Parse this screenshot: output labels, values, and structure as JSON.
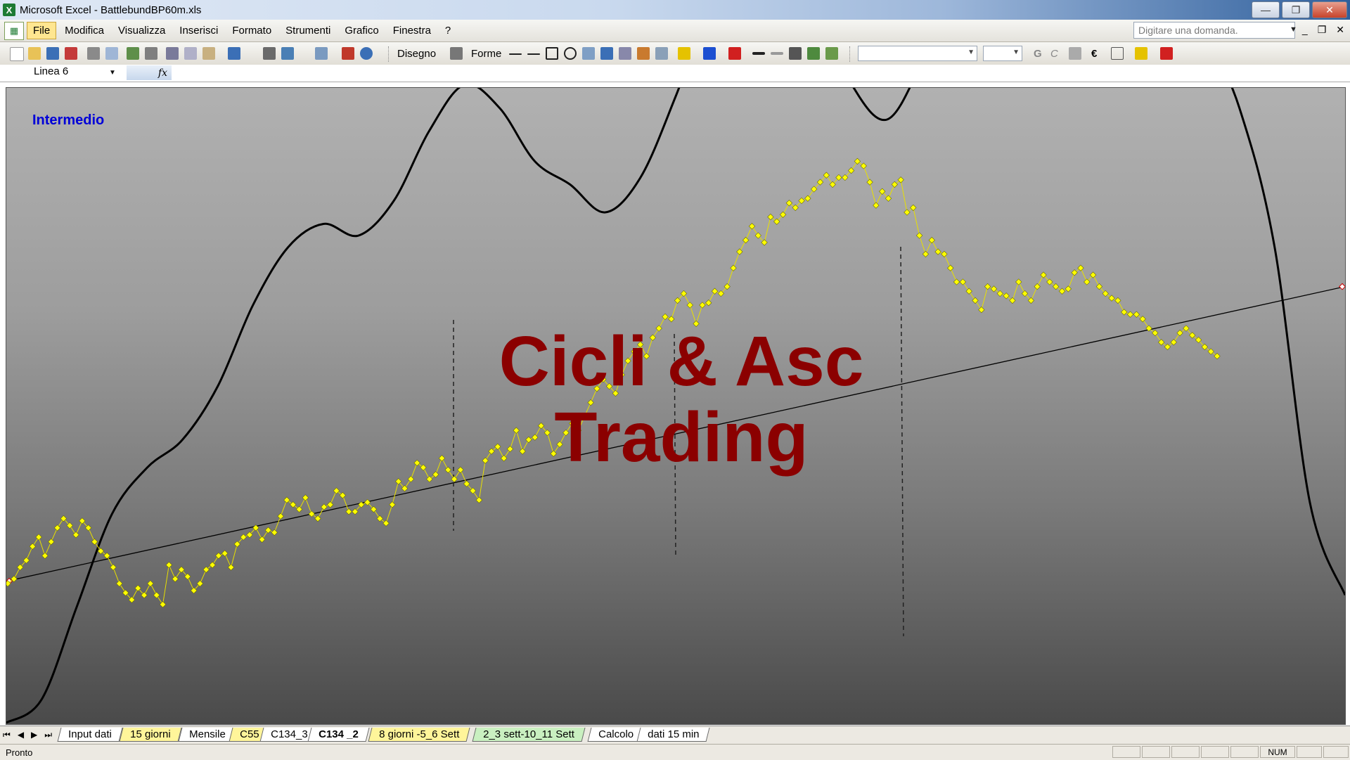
{
  "window": {
    "title": "Microsoft Excel - BattlebundBP60m.xls",
    "buttons": [
      "—",
      "❐",
      "✕"
    ]
  },
  "menubar": {
    "items": [
      "File",
      "Modifica",
      "Visualizza",
      "Inserisci",
      "Formato",
      "Strumenti",
      "Grafico",
      "Finestra",
      "?"
    ],
    "ask_placeholder": "Digitare una domanda."
  },
  "toolbar": {
    "drawing_label": "Disegno",
    "shapes_label": "Forme"
  },
  "formula_bar": {
    "name_box": "Linea 6",
    "fx_label": "fx"
  },
  "chart": {
    "label": "Intermedio",
    "watermark_line1": "Cicli & Asc",
    "watermark_line2": "Trading",
    "colors": {
      "price_points": "#ffff00",
      "cycle_line": "#000000",
      "trend_line": "#000000",
      "label": "#0000d8",
      "watermark": "#8b0000"
    }
  },
  "chart_data": {
    "type": "line",
    "title": "Intermedio",
    "xlabel": "",
    "ylabel": "",
    "grid": false,
    "legend": "none",
    "series": [
      {
        "style": "yellow diamond markers",
        "values": [
          50,
          52,
          57,
          60,
          66,
          70,
          62,
          68,
          74,
          78,
          75,
          71,
          77,
          74,
          68,
          64,
          62,
          57,
          50,
          46,
          43,
          48,
          45,
          50,
          45,
          41,
          58,
          52,
          56,
          53,
          47,
          50,
          56,
          58,
          62,
          63,
          57,
          67,
          70,
          71,
          74,
          69,
          73,
          72,
          79,
          86,
          84,
          82,
          87,
          80,
          78,
          83,
          84,
          90,
          88,
          81,
          81,
          84,
          85,
          82,
          78,
          76,
          84,
          94,
          91,
          95,
          102,
          100,
          95,
          97,
          104,
          99,
          95,
          99,
          93,
          90,
          86,
          103,
          107,
          109,
          104,
          108,
          116,
          107,
          112,
          113,
          118,
          115,
          106,
          110,
          115,
          119,
          116,
          122,
          128,
          134,
          138,
          135,
          132,
          140,
          146,
          150,
          153,
          148,
          156,
          160,
          165,
          164,
          172,
          175,
          170,
          162,
          170,
          171,
          176,
          175,
          178,
          186,
          193,
          198,
          204,
          200,
          197,
          208,
          206,
          209,
          214,
          212,
          215,
          216,
          220,
          223,
          226,
          222,
          225,
          225,
          228,
          232,
          230,
          223,
          213,
          219,
          216,
          222,
          224,
          210,
          212,
          200,
          192,
          198,
          193,
          192,
          186,
          180,
          180,
          176,
          172,
          168,
          178,
          177,
          175,
          174,
          172,
          180,
          175,
          172,
          178,
          183,
          180,
          178,
          176,
          177,
          184,
          186,
          180,
          183,
          178,
          175,
          173,
          172,
          167,
          166,
          166,
          164,
          160,
          158,
          154,
          152,
          154,
          158,
          160,
          157,
          155,
          152,
          150,
          148
        ]
      },
      {
        "style": "black smooth cycle line",
        "values": [
          -10,
          0,
          40,
          80,
          100,
          112,
          135,
          170,
          195,
          205,
          200,
          215,
          245,
          265,
          255,
          232,
          222,
          210,
          225,
          260,
          300,
          325,
          325,
          300,
          265,
          250,
          275,
          310,
          345,
          365,
          385,
          390,
          368,
          335,
          290,
          255,
          195,
          85,
          45
        ]
      },
      {
        "style": "thin black trend line",
        "values": [
          [
            0,
            51
          ],
          [
            1,
            178
          ]
        ]
      }
    ],
    "vertical_markers": [
      "dashed",
      "dashed",
      "dashed"
    ]
  },
  "sheet_tabs": [
    {
      "label": "Input dati",
      "color": "white"
    },
    {
      "label": "15 giorni",
      "color": "yellow"
    },
    {
      "label": "Mensile",
      "color": "white"
    },
    {
      "label": "C55",
      "color": "yellow"
    },
    {
      "label": "C134_3",
      "color": "white"
    },
    {
      "label": "C134 _2",
      "color": "white",
      "active": true
    },
    {
      "label": "8 giorni -5_6 Sett",
      "color": "yellow"
    },
    {
      "label": "2_3 sett-10_11 Sett",
      "color": "green"
    },
    {
      "label": "Calcolo",
      "color": "white"
    },
    {
      "label": "dati 15 min",
      "color": "white"
    }
  ],
  "statusbar": {
    "text": "Pronto",
    "num": "NUM"
  }
}
